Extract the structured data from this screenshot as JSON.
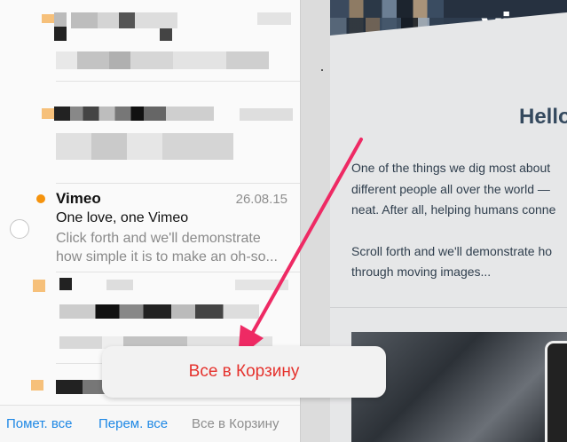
{
  "mail_list": {
    "active_message": {
      "sender": "Vimeo",
      "date": "26.08.15",
      "subject": "One love, one Vimeo",
      "preview_line1": "Click forth and we'll demonstrate",
      "preview_line2": "how simple it is to make an oh-so..."
    }
  },
  "toolbar": {
    "mark_all_label": "Помет. все",
    "move_all_label": "Перем. все",
    "trash_all_label": "Все в Корзину"
  },
  "popup": {
    "label": "Все в Корзину"
  },
  "email": {
    "logo_text": "vimeo",
    "heading": "Hello",
    "paragraph1_line1": "One of the things we dig most about",
    "paragraph1_line2": "different people all over the world —",
    "paragraph1_line3": "neat. After all, helping humans conne",
    "paragraph2_line1": "Scroll forth and we'll demonstrate ho",
    "paragraph2_line2": "through moving images..."
  },
  "colors": {
    "accent_blue": "#1e88e5",
    "unread_orange": "#f5930d",
    "popup_red": "#e5322d",
    "arrow_pink": "#ee2a64"
  }
}
